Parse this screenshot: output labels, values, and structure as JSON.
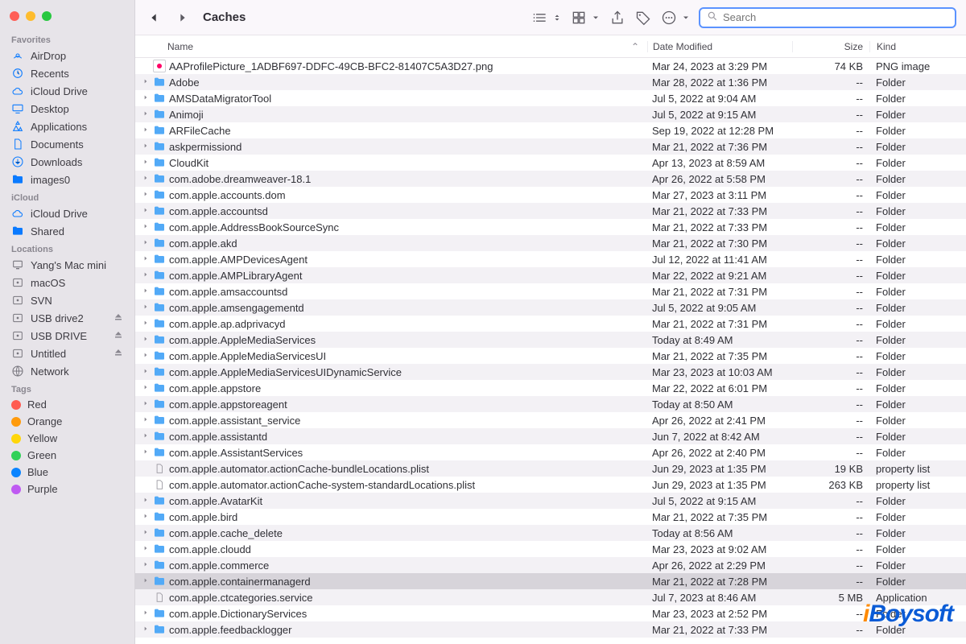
{
  "window": {
    "title": "Caches"
  },
  "toolbar": {
    "search_placeholder": "Search"
  },
  "sidebar": {
    "favorites_label": "Favorites",
    "favorites": [
      {
        "label": "AirDrop",
        "icon": "airdrop"
      },
      {
        "label": "Recents",
        "icon": "clock"
      },
      {
        "label": "iCloud Drive",
        "icon": "cloud"
      },
      {
        "label": "Desktop",
        "icon": "desktop"
      },
      {
        "label": "Applications",
        "icon": "apps"
      },
      {
        "label": "Documents",
        "icon": "doc"
      },
      {
        "label": "Downloads",
        "icon": "download"
      },
      {
        "label": "images0",
        "icon": "folder"
      }
    ],
    "icloud_label": "iCloud",
    "icloud": [
      {
        "label": "iCloud Drive",
        "icon": "cloud"
      },
      {
        "label": "Shared",
        "icon": "sharedfolder"
      }
    ],
    "locations_label": "Locations",
    "locations": [
      {
        "label": "Yang's Mac mini",
        "icon": "computer",
        "gray": true
      },
      {
        "label": "macOS",
        "icon": "disk",
        "gray": true
      },
      {
        "label": "SVN",
        "icon": "disk",
        "gray": true
      },
      {
        "label": "USB drive2",
        "icon": "disk",
        "gray": true,
        "eject": true
      },
      {
        "label": "USB DRIVE",
        "icon": "disk",
        "gray": true,
        "eject": true
      },
      {
        "label": "Untitled",
        "icon": "disk",
        "gray": true,
        "eject": true
      },
      {
        "label": "Network",
        "icon": "network",
        "gray": true
      }
    ],
    "tags_label": "Tags",
    "tags": [
      {
        "label": "Red",
        "color": "#ff5b51"
      },
      {
        "label": "Orange",
        "color": "#ff9a0b"
      },
      {
        "label": "Yellow",
        "color": "#ffd60a"
      },
      {
        "label": "Green",
        "color": "#31d158"
      },
      {
        "label": "Blue",
        "color": "#0b84ff"
      },
      {
        "label": "Purple",
        "color": "#bf5af2"
      }
    ]
  },
  "columns": {
    "name": "Name",
    "date": "Date Modified",
    "size": "Size",
    "kind": "Kind"
  },
  "files": [
    {
      "name": "AAProfilePicture_1ADBF697-DDFC-49CB-BFC2-81407C5A3D27.png",
      "date": "Mar 24, 2023 at 3:29 PM",
      "size": "74 KB",
      "kind": "PNG image",
      "type": "png"
    },
    {
      "name": "Adobe",
      "date": "Mar 28, 2022 at 1:36 PM",
      "size": "--",
      "kind": "Folder",
      "type": "folder"
    },
    {
      "name": "AMSDataMigratorTool",
      "date": "Jul 5, 2022 at 9:04 AM",
      "size": "--",
      "kind": "Folder",
      "type": "folder"
    },
    {
      "name": "Animoji",
      "date": "Jul 5, 2022 at 9:15 AM",
      "size": "--",
      "kind": "Folder",
      "type": "folder"
    },
    {
      "name": "ARFileCache",
      "date": "Sep 19, 2022 at 12:28 PM",
      "size": "--",
      "kind": "Folder",
      "type": "folder"
    },
    {
      "name": "askpermissiond",
      "date": "Mar 21, 2022 at 7:36 PM",
      "size": "--",
      "kind": "Folder",
      "type": "folder"
    },
    {
      "name": "CloudKit",
      "date": "Apr 13, 2023 at 8:59 AM",
      "size": "--",
      "kind": "Folder",
      "type": "folder"
    },
    {
      "name": "com.adobe.dreamweaver-18.1",
      "date": "Apr 26, 2022 at 5:58 PM",
      "size": "--",
      "kind": "Folder",
      "type": "folder"
    },
    {
      "name": "com.apple.accounts.dom",
      "date": "Mar 27, 2023 at 3:11 PM",
      "size": "--",
      "kind": "Folder",
      "type": "folder"
    },
    {
      "name": "com.apple.accountsd",
      "date": "Mar 21, 2022 at 7:33 PM",
      "size": "--",
      "kind": "Folder",
      "type": "folder"
    },
    {
      "name": "com.apple.AddressBookSourceSync",
      "date": "Mar 21, 2022 at 7:33 PM",
      "size": "--",
      "kind": "Folder",
      "type": "folder"
    },
    {
      "name": "com.apple.akd",
      "date": "Mar 21, 2022 at 7:30 PM",
      "size": "--",
      "kind": "Folder",
      "type": "folder"
    },
    {
      "name": "com.apple.AMPDevicesAgent",
      "date": "Jul 12, 2022 at 11:41 AM",
      "size": "--",
      "kind": "Folder",
      "type": "folder"
    },
    {
      "name": "com.apple.AMPLibraryAgent",
      "date": "Mar 22, 2022 at 9:21 AM",
      "size": "--",
      "kind": "Folder",
      "type": "folder"
    },
    {
      "name": "com.apple.amsaccountsd",
      "date": "Mar 21, 2022 at 7:31 PM",
      "size": "--",
      "kind": "Folder",
      "type": "folder"
    },
    {
      "name": "com.apple.amsengagementd",
      "date": "Jul 5, 2022 at 9:05 AM",
      "size": "--",
      "kind": "Folder",
      "type": "folder"
    },
    {
      "name": "com.apple.ap.adprivacyd",
      "date": "Mar 21, 2022 at 7:31 PM",
      "size": "--",
      "kind": "Folder",
      "type": "folder"
    },
    {
      "name": "com.apple.AppleMediaServices",
      "date": "Today at 8:49 AM",
      "size": "--",
      "kind": "Folder",
      "type": "folder"
    },
    {
      "name": "com.apple.AppleMediaServicesUI",
      "date": "Mar 21, 2022 at 7:35 PM",
      "size": "--",
      "kind": "Folder",
      "type": "folder"
    },
    {
      "name": "com.apple.AppleMediaServicesUIDynamicService",
      "date": "Mar 23, 2023 at 10:03 AM",
      "size": "--",
      "kind": "Folder",
      "type": "folder"
    },
    {
      "name": "com.apple.appstore",
      "date": "Mar 22, 2022 at 6:01 PM",
      "size": "--",
      "kind": "Folder",
      "type": "folder"
    },
    {
      "name": "com.apple.appstoreagent",
      "date": "Today at 8:50 AM",
      "size": "--",
      "kind": "Folder",
      "type": "folder"
    },
    {
      "name": "com.apple.assistant_service",
      "date": "Apr 26, 2022 at 2:41 PM",
      "size": "--",
      "kind": "Folder",
      "type": "folder"
    },
    {
      "name": "com.apple.assistantd",
      "date": "Jun 7, 2022 at 8:42 AM",
      "size": "--",
      "kind": "Folder",
      "type": "folder"
    },
    {
      "name": "com.apple.AssistantServices",
      "date": "Apr 26, 2022 at 2:40 PM",
      "size": "--",
      "kind": "Folder",
      "type": "folder"
    },
    {
      "name": "com.apple.automator.actionCache-bundleLocations.plist",
      "date": "Jun 29, 2023 at 1:35 PM",
      "size": "19 KB",
      "kind": "property list",
      "type": "plist"
    },
    {
      "name": "com.apple.automator.actionCache-system-standardLocations.plist",
      "date": "Jun 29, 2023 at 1:35 PM",
      "size": "263 KB",
      "kind": "property list",
      "type": "plist"
    },
    {
      "name": "com.apple.AvatarKit",
      "date": "Jul 5, 2022 at 9:15 AM",
      "size": "--",
      "kind": "Folder",
      "type": "folder"
    },
    {
      "name": "com.apple.bird",
      "date": "Mar 21, 2022 at 7:35 PM",
      "size": "--",
      "kind": "Folder",
      "type": "folder"
    },
    {
      "name": "com.apple.cache_delete",
      "date": "Today at 8:56 AM",
      "size": "--",
      "kind": "Folder",
      "type": "folder"
    },
    {
      "name": "com.apple.cloudd",
      "date": "Mar 23, 2023 at 9:02 AM",
      "size": "--",
      "kind": "Folder",
      "type": "folder"
    },
    {
      "name": "com.apple.commerce",
      "date": "Apr 26, 2022 at 2:29 PM",
      "size": "--",
      "kind": "Folder",
      "type": "folder"
    },
    {
      "name": "com.apple.containermanagerd",
      "date": "Mar 21, 2022 at 7:28 PM",
      "size": "--",
      "kind": "Folder",
      "type": "folder",
      "selected": true
    },
    {
      "name": "com.apple.ctcategories.service",
      "date": "Jul 7, 2023 at 8:46 AM",
      "size": "5 MB",
      "kind": "Application",
      "type": "app"
    },
    {
      "name": "com.apple.DictionaryServices",
      "date": "Mar 23, 2023 at 2:52 PM",
      "size": "--",
      "kind": "Folder",
      "type": "folder"
    },
    {
      "name": "com.apple.feedbacklogger",
      "date": "Mar 21, 2022 at 7:33 PM",
      "size": "--",
      "kind": "Folder",
      "type": "folder"
    }
  ],
  "watermark": "iBoysoft"
}
